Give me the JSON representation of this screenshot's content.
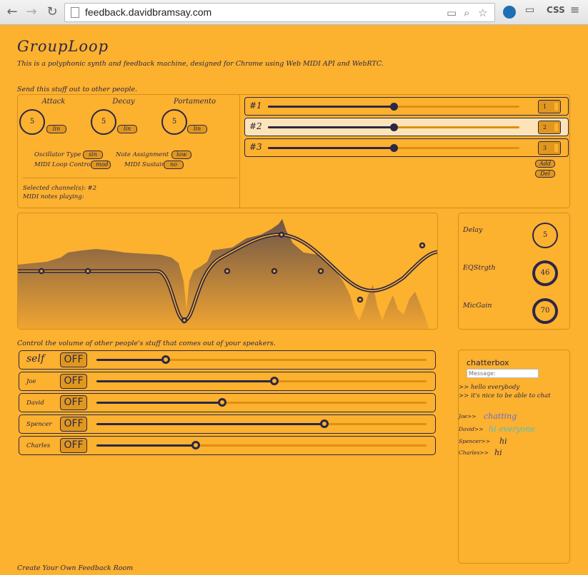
{
  "browser": {
    "url": "feedback.davidbramsay.com",
    "ext_label": "CSS"
  },
  "app": {
    "title": "GroupLoop",
    "subtitle": "This is a polyphonic synth and feedback machine, designed for Chrome using Web MIDI API and WebRTC.",
    "send_label": "Send this stuff out to other people.",
    "knobs": [
      {
        "label": "Attack",
        "value": "5",
        "unit": "lin"
      },
      {
        "label": "Decay",
        "value": "5",
        "unit": "lin"
      },
      {
        "label": "Portamento",
        "value": "5",
        "unit": "lin"
      }
    ],
    "options": {
      "osc_label": "Oscillator Type",
      "osc_value": "sin",
      "note_label": "Note Assignment",
      "note_value": "low",
      "loop_label": "MIDI Loop Control",
      "loop_value": "mod",
      "sustain_label": "MIDI Sustain",
      "sustain_value": "no"
    },
    "selected_channels": "Selected channel(s): #2",
    "midi_notes": "MIDI notes playing:",
    "channels": [
      {
        "label": "#1",
        "value": "1",
        "level": 0.5,
        "selected": false
      },
      {
        "label": "#2",
        "value": "2",
        "level": 0.5,
        "selected": true
      },
      {
        "label": "#3",
        "value": "3",
        "level": 0.5,
        "selected": false
      }
    ],
    "add_label": "Add",
    "del_label": "Del",
    "effects": [
      {
        "label": "Delay",
        "value": "5",
        "level": 0
      },
      {
        "label": "EQStrgth",
        "value": "46",
        "level": 0.46
      },
      {
        "label": "MicGain",
        "value": "70",
        "level": 0.7
      }
    ],
    "volume_label": "Control the volume of other people's stuff that comes out of your speakers.",
    "volumes": [
      {
        "name": "self",
        "toggle": "OFF",
        "level": 0.21
      },
      {
        "name": "Joe",
        "toggle": "OFF",
        "level": 0.54
      },
      {
        "name": "David",
        "toggle": "OFF",
        "level": 0.38
      },
      {
        "name": "Spencer",
        "toggle": "OFF",
        "level": 0.69
      },
      {
        "name": "Charles",
        "toggle": "OFF",
        "level": 0.3
      }
    ],
    "chat": {
      "title": "chatterbox",
      "placeholder": "Message:",
      "system": [
        ">> hello everybody",
        ">> it's nice to be able to chat"
      ],
      "messages": [
        {
          "user": "Joe>>",
          "text": "chatting",
          "color": "#6b6bd6"
        },
        {
          "user": "David>>",
          "text": "hi everyone",
          "color": "#49c0c9"
        },
        {
          "user": "Spencer>>",
          "text": "hi",
          "color": "#2c2747"
        },
        {
          "user": "Charles>>",
          "text": "hi",
          "color": "#2c2747"
        }
      ]
    },
    "footer_link": "Create Your Own Feedback Room"
  }
}
